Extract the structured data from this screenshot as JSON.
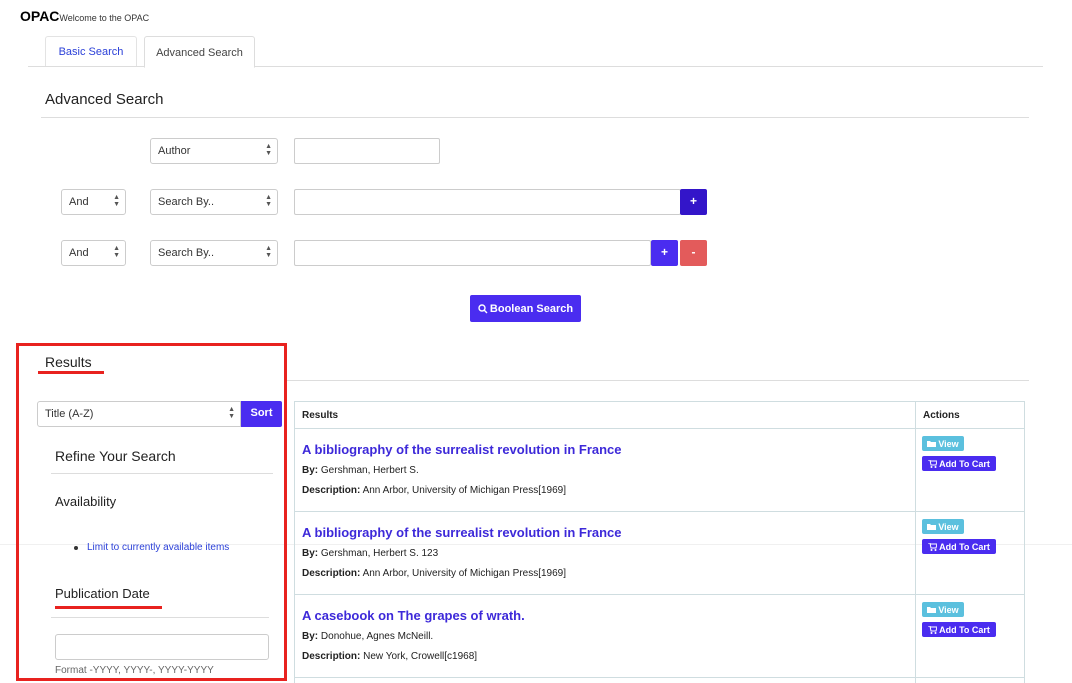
{
  "header": {
    "brand": "OPAC",
    "welcome": "Welcome to the OPAC"
  },
  "tabs": [
    {
      "label": "Basic Search"
    },
    {
      "label": "Advanced Search"
    }
  ],
  "advanced": {
    "title": "Advanced Search",
    "row1": {
      "field": "Author",
      "query": ""
    },
    "row2": {
      "operator": "And",
      "field": "Search By..",
      "query": ""
    },
    "row3": {
      "operator": "And",
      "field": "Search By..",
      "query": ""
    },
    "plus_label": "+",
    "minus_label": "-",
    "boolean_label": "Boolean Search"
  },
  "results": {
    "title": "Results",
    "sort_select": "Title (A-Z)",
    "sort_label": "Sort",
    "table_headers": {
      "results": "Results",
      "actions": "Actions"
    },
    "by_label": "By:",
    "desc_label": "Description:",
    "view_label": "View",
    "cart_label": "Add To Cart",
    "items": [
      {
        "title": "A bibliography of the surrealist revolution in France",
        "author": "Gershman, Herbert S.",
        "description": "Ann Arbor, University of Michigan Press[1969]"
      },
      {
        "title": "A bibliography of the surrealist revolution in France",
        "author": "Gershman, Herbert S. 123",
        "description": "Ann Arbor, University of Michigan Press[1969]"
      },
      {
        "title": "A casebook on The grapes of wrath.",
        "author": "Donohue, Agnes McNeill.",
        "description": "New York, Crowell[c1968]"
      }
    ]
  },
  "refine": {
    "title": "Refine Your Search",
    "availability": "Availability",
    "limit_link": "Limit to currently available items",
    "pubdate": "Publication Date",
    "pubdate_value": "",
    "format_hint": "Format -YYYY, YYYY-, YYYY-YYYY"
  },
  "colors": {
    "accent": "#4a2cf0",
    "danger": "#e35b5b",
    "info": "#5bc0de",
    "highlight": "#e8221f"
  }
}
